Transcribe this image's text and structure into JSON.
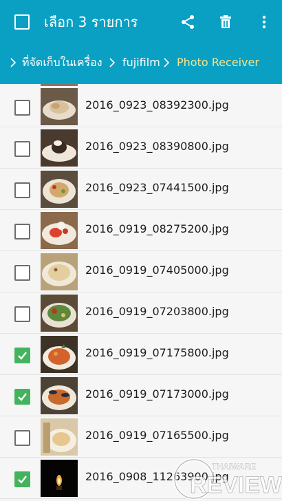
{
  "toolbar": {
    "title": "เลือก 3 รายการ",
    "select_all_checked": false,
    "icons": [
      "checkbox-icon",
      "share-icon",
      "delete-icon",
      "more-vert-icon"
    ]
  },
  "breadcrumb": {
    "items": [
      "ที่จัดเก็บในเครื่อง",
      "fujifilm",
      "Photo Receiver"
    ]
  },
  "files": [
    {
      "name": "2016_0923_08392300.jpg",
      "checked": false
    },
    {
      "name": "2016_0923_08390800.jpg",
      "checked": false
    },
    {
      "name": "2016_0923_07441500.jpg",
      "checked": false
    },
    {
      "name": "2016_0919_08275200.jpg",
      "checked": false
    },
    {
      "name": "2016_0919_07405000.jpg",
      "checked": false
    },
    {
      "name": "2016_0919_07203800.jpg",
      "checked": false
    },
    {
      "name": "2016_0919_07175800.jpg",
      "checked": true
    },
    {
      "name": "2016_0919_07173000.jpg",
      "checked": true
    },
    {
      "name": "2016_0919_07165500.jpg",
      "checked": false
    },
    {
      "name": "2016_0908_11263900.jpg",
      "checked": true
    }
  ],
  "watermark": {
    "brand": "THAIWARE",
    "word": "REVIEW"
  },
  "colors": {
    "appbar": "#0aa0c4",
    "checked": "#45b35e",
    "active_crumb": "#f6e58d"
  }
}
